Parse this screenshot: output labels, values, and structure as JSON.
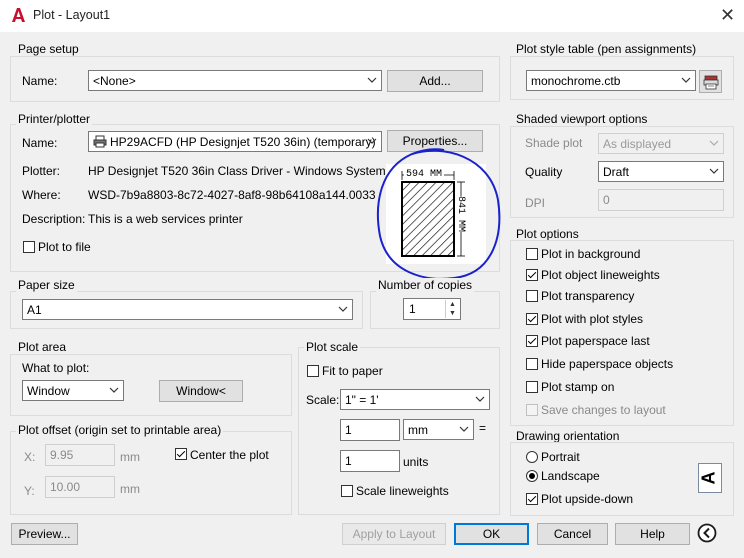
{
  "window": {
    "title": "Plot - Layout1",
    "app_icon": "autocad-a-icon",
    "close_icon": "close-icon"
  },
  "page_setup": {
    "legend": "Page setup",
    "name_label": "Name:",
    "name_value": "<None>",
    "add_button": "Add..."
  },
  "printer": {
    "legend": "Printer/plotter",
    "name_label": "Name:",
    "name_value": "HP29ACFD (HP Designjet T520 36in) (temporary)",
    "properties_button": "Properties...",
    "plotter_label": "Plotter:",
    "plotter_value": "HP Designjet T520 36in Class Driver - Windows System ...",
    "where_label": "Where:",
    "where_value": "WSD-7b9a8803-8c72-4027-8af8-98b64108a144.0033",
    "description_label": "Description:",
    "description_value": "This is a web services printer",
    "plot_to_file_label": "Plot to file",
    "plot_to_file_checked": false,
    "preview_width": "594",
    "preview_height": "841",
    "preview_unit": "MM"
  },
  "paper_size": {
    "legend": "Paper size",
    "value": "A1"
  },
  "copies": {
    "legend": "Number of copies",
    "value": "1"
  },
  "plot_area": {
    "legend": "Plot area",
    "what_label": "What to plot:",
    "what_value": "Window",
    "window_button": "Window<"
  },
  "plot_offset": {
    "legend": "Plot offset (origin set to printable area)",
    "x_label": "X:",
    "x_value": "9.95",
    "x_unit": "mm",
    "y_label": "Y:",
    "y_value": "10.00",
    "y_unit": "mm",
    "center_label": "Center the plot",
    "center_checked": true
  },
  "plot_scale": {
    "legend": "Plot scale",
    "fit_label": "Fit to paper",
    "fit_checked": false,
    "scale_label": "Scale:",
    "scale_value": "1\" = 1'",
    "num_value": "1",
    "unit_value": "mm",
    "equals": "=",
    "den_value": "1",
    "den_unit": "units",
    "lineweights_label": "Scale lineweights",
    "lineweights_checked": false
  },
  "plot_style": {
    "legend": "Plot style table (pen assignments)",
    "value": "monochrome.ctb",
    "edit_icon": "edit-plot-style-icon"
  },
  "shaded": {
    "legend": "Shaded viewport options",
    "shade_label": "Shade plot",
    "shade_value": "As displayed",
    "quality_label": "Quality",
    "quality_value": "Draft",
    "dpi_label": "DPI",
    "dpi_value": "0"
  },
  "plot_options": {
    "legend": "Plot options",
    "items": [
      {
        "label": "Plot in background",
        "checked": false,
        "disabled": false
      },
      {
        "label": "Plot object lineweights",
        "checked": true,
        "disabled": false
      },
      {
        "label": "Plot transparency",
        "checked": false,
        "disabled": false
      },
      {
        "label": "Plot with plot styles",
        "checked": true,
        "disabled": false
      },
      {
        "label": "Plot paperspace last",
        "checked": true,
        "disabled": false
      },
      {
        "label": "Hide paperspace objects",
        "checked": false,
        "disabled": false
      },
      {
        "label": "Plot stamp on",
        "checked": false,
        "disabled": false
      },
      {
        "label": "Save changes to layout",
        "checked": false,
        "disabled": true
      }
    ]
  },
  "orientation": {
    "legend": "Drawing orientation",
    "portrait_label": "Portrait",
    "landscape_label": "Landscape",
    "selected": "Landscape",
    "upside_down_label": "Plot upside-down",
    "upside_down_checked": true,
    "icon_letter": "A"
  },
  "footer": {
    "preview_button": "Preview...",
    "apply_button": "Apply to Layout",
    "ok_button": "OK",
    "cancel_button": "Cancel",
    "help_button": "Help",
    "collapse_icon": "chevron-left-circle-icon"
  },
  "colors": {
    "annotation": "#1a22cc",
    "focus": "#0078d7"
  }
}
